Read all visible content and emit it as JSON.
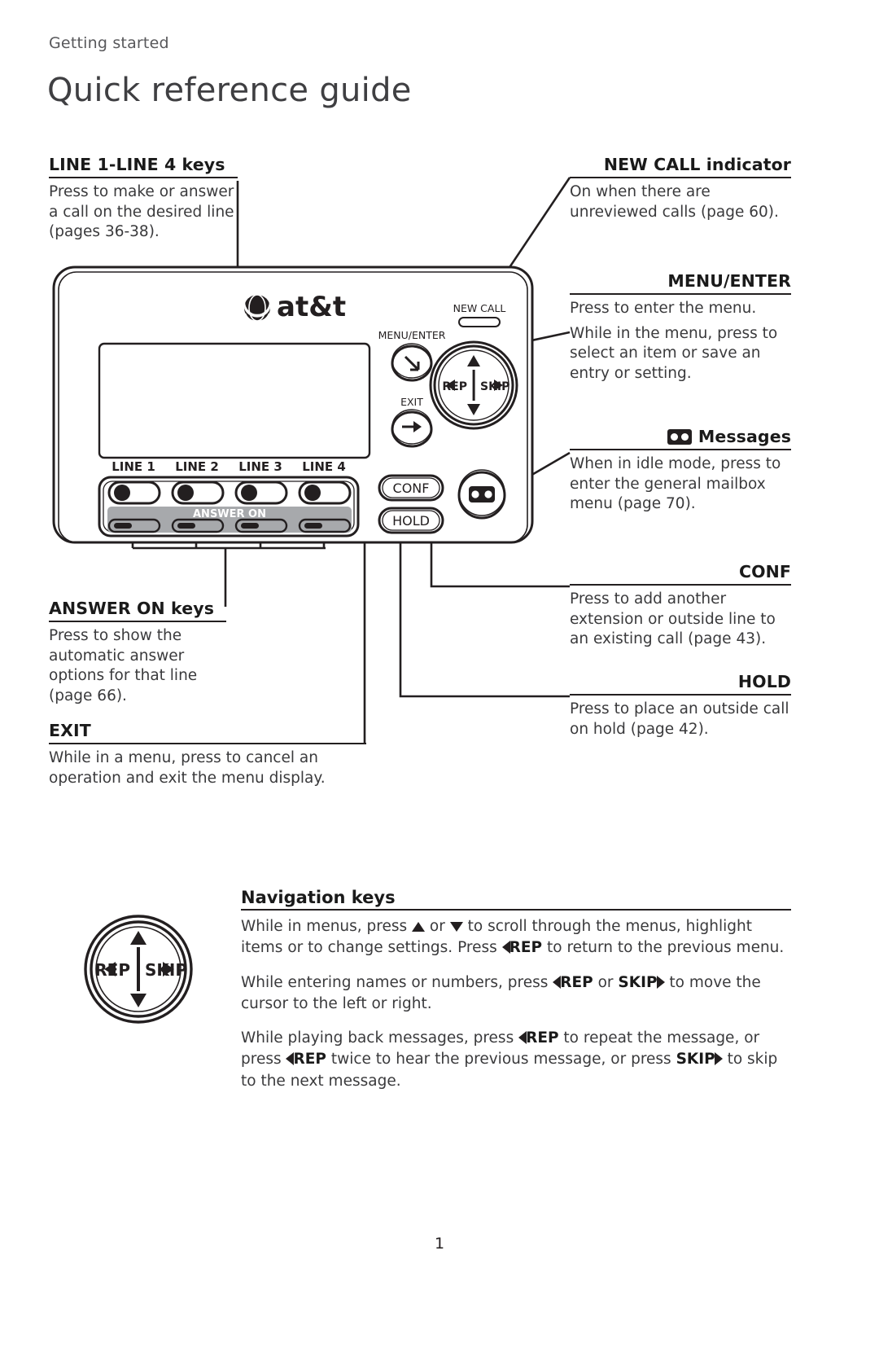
{
  "header": {
    "running_head": "Getting started",
    "title": "Quick reference guide"
  },
  "callouts": {
    "line_keys": {
      "heading": "LINE 1-LINE 4 keys",
      "body": "Press to make or answer a call on the desired line (pages 36-38)."
    },
    "new_call": {
      "heading": "NEW CALL indicator",
      "body": "On when there are unreviewed calls (page 60)."
    },
    "menu_enter": {
      "heading": "MENU/ENTER",
      "body_1": "Press to enter the menu.",
      "body_2": "While in the menu, press to select an item or save an entry or setting."
    },
    "messages": {
      "icon": "cassette-icon",
      "heading": "Messages",
      "body": "When in idle mode, press to enter the general mailbox menu (page 70)."
    },
    "conf": {
      "heading": "CONF",
      "body": "Press to add another extension or outside line to an existing call (page 43)."
    },
    "hold": {
      "heading": "HOLD",
      "body": "Press to place an outside call on hold (page 42)."
    },
    "answer_on": {
      "heading": "ANSWER ON keys",
      "body": "Press to show the automatic answer options for that line (page 66)."
    },
    "exit": {
      "heading": "EXIT",
      "body": "While in a menu, press to cancel an operation and exit the menu display."
    }
  },
  "phone": {
    "brand": "at&t",
    "new_call_label": "NEW CALL",
    "menu_enter_label": "MENU/ENTER",
    "exit_label": "EXIT",
    "conf_label": "CONF",
    "hold_label": "HOLD",
    "answer_on_label": "ANSWER ON",
    "rep_label": "REP",
    "skip_label": "SKIP",
    "line_labels": [
      "LINE 1",
      "LINE 2",
      "LINE 3",
      "LINE 4"
    ]
  },
  "navigation": {
    "heading": "Navigation keys",
    "wheel": {
      "rep_label": "REP",
      "skip_label": "SKIP"
    },
    "p1": {
      "a": "While in menus, press ",
      "b": " or ",
      "c": " to scroll through the menus, highlight items or to change settings. Press ",
      "rep": "REP",
      "d": " to return to the previous menu."
    },
    "p2": {
      "a": "While entering names or numbers, press ",
      "rep": "REP",
      "b": " or ",
      "skip": "SKIP",
      "c": " to move the cursor to the left or right."
    },
    "p3": {
      "a": "While playing back messages, press ",
      "rep1": "REP",
      "b": " to repeat the message, or press ",
      "rep2": "REP",
      "c": " twice to hear the previous message, or press ",
      "skip": "SKIP",
      "d": " to skip to the next message."
    }
  },
  "footer": {
    "page_number": "1"
  },
  "colors": {
    "ink": "#231f20",
    "body_text": "#3a3a3c",
    "running_head": "#58585b",
    "answer_bar": "#a7a9ac"
  }
}
